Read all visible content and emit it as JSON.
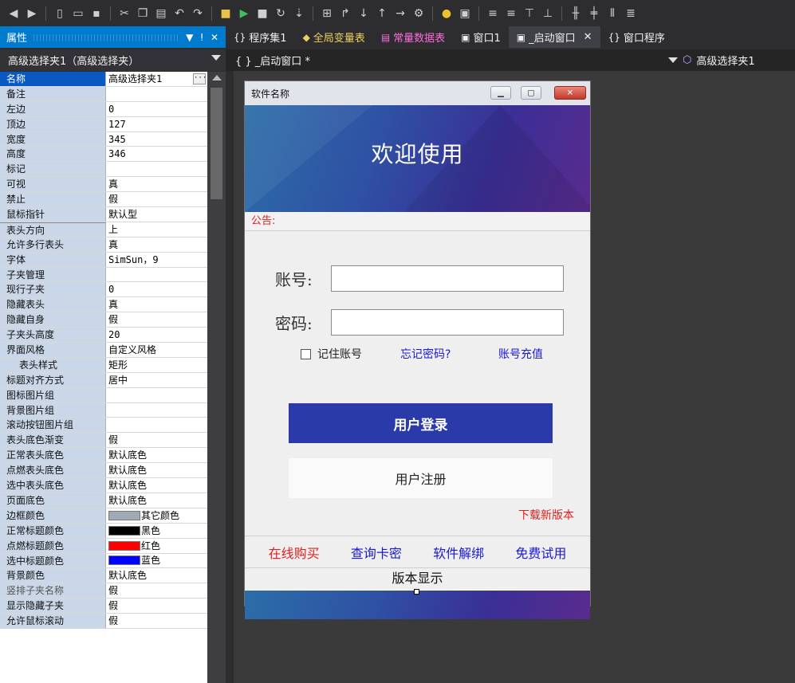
{
  "toolbar": {
    "icons": [
      "back-icon",
      "forward-icon",
      "new-icon",
      "open-icon",
      "save-icon",
      "cut-icon",
      "copy-icon",
      "paste-icon",
      "undo-icon",
      "redo-icon",
      "build-icon",
      "run-icon",
      "stop-icon",
      "refresh-icon",
      "deploy-icon",
      "layout-icon",
      "align-icon",
      "bulb-icon",
      "window-icon"
    ]
  },
  "properties": {
    "panel_title": "属性",
    "object_name": "高级选择夹1（高级选择夹）",
    "rows": [
      {
        "k": "名称",
        "v": "高级选择夹1",
        "type": "selected"
      },
      {
        "k": "备注",
        "v": ""
      },
      {
        "k": "左边",
        "v": "0"
      },
      {
        "k": "顶边",
        "v": "127"
      },
      {
        "k": "宽度",
        "v": "345"
      },
      {
        "k": "高度",
        "v": "346"
      },
      {
        "k": "标记",
        "v": ""
      },
      {
        "k": "可视",
        "v": "真"
      },
      {
        "k": "禁止",
        "v": "假"
      },
      {
        "k": "鼠标指针",
        "v": "默认型"
      },
      {
        "k": "表头方向",
        "v": "上",
        "type": "section"
      },
      {
        "k": "允许多行表头",
        "v": "真"
      },
      {
        "k": "字体",
        "v": "SimSun，9"
      },
      {
        "k": "子夹管理",
        "v": ""
      },
      {
        "k": "现行子夹",
        "v": "0"
      },
      {
        "k": "隐藏表头",
        "v": "真"
      },
      {
        "k": "隐藏自身",
        "v": "假"
      },
      {
        "k": "子夹头高度",
        "v": "20"
      },
      {
        "k": "界面风格",
        "v": "自定义风格"
      },
      {
        "k": "表头样式",
        "v": "矩形",
        "type": "indent"
      },
      {
        "k": "标题对齐方式",
        "v": "居中"
      },
      {
        "k": "图标图片组",
        "v": ""
      },
      {
        "k": "背景图片组",
        "v": ""
      },
      {
        "k": "滚动按钮图片组",
        "v": ""
      },
      {
        "k": "表头底色渐变",
        "v": "假"
      },
      {
        "k": "正常表头底色",
        "v": "默认底色"
      },
      {
        "k": "点燃表头底色",
        "v": "默认底色"
      },
      {
        "k": "选中表头底色",
        "v": "默认底色"
      },
      {
        "k": "页面底色",
        "v": "默认底色"
      },
      {
        "k": "边框颜色",
        "v": "其它颜色",
        "swatch": "#a0aab4"
      },
      {
        "k": "正常标题颜色",
        "v": "黑色",
        "swatch": "#000000"
      },
      {
        "k": "点燃标题颜色",
        "v": "红色",
        "swatch": "#ff0000"
      },
      {
        "k": "选中标题颜色",
        "v": "蓝色",
        "swatch": "#0000ff"
      },
      {
        "k": "背景颜色",
        "v": "默认底色"
      },
      {
        "k": "竖排子夹名称",
        "v": "假",
        "type": "gray"
      },
      {
        "k": "显示隐藏子夹",
        "v": "假"
      },
      {
        "k": "允许鼠标滚动",
        "v": "假"
      }
    ]
  },
  "tabs": [
    {
      "label": "程序集1",
      "icon": "{}",
      "style": ""
    },
    {
      "label": "全局变量表",
      "icon": "◆",
      "style": "yellow"
    },
    {
      "label": "常量数据表",
      "icon": "▤",
      "style": "pink"
    },
    {
      "label": "窗口1",
      "icon": "▣",
      "style": ""
    },
    {
      "label": "_启动窗口",
      "icon": "▣",
      "style": "active"
    },
    {
      "label": "窗口程序",
      "icon": "{}",
      "style": ""
    }
  ],
  "doc_bar": {
    "left": "{ } _启动窗口 *",
    "right": "高级选择夹1"
  },
  "window": {
    "title": "软件名称",
    "banner_title": "欢迎使用",
    "notice": "公告:",
    "account_label": "账号:",
    "password_label": "密码:",
    "remember": "记住账号",
    "forgot": "忘记密码?",
    "recharge": "账号充值",
    "login": "用户登录",
    "register": "用户注册",
    "download": "下载新版本",
    "links": [
      "在线购买",
      "查询卡密",
      "软件解绑",
      "免费试用"
    ],
    "version": "版本显示"
  },
  "colors": {
    "accent": "#007acc",
    "login_button": "#2a3aa8",
    "red_text": "#e02020",
    "blue_text": "#1a1ad0"
  }
}
